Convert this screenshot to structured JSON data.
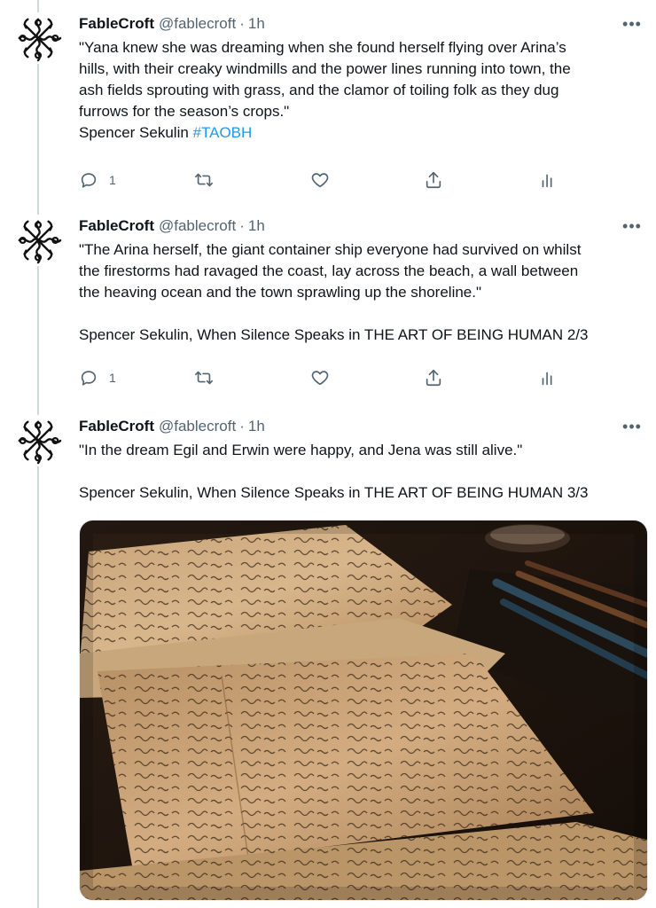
{
  "author": {
    "name": "FableCroft",
    "handle": "@fablecroft",
    "separator": "·",
    "avatar_icon": "celtic-knot-logo-icon"
  },
  "more_icon_label": "•••",
  "tweets": [
    {
      "time": "1h",
      "lines": [
        "\"Yana knew she was dreaming when she found herself flying over Arina’s",
        "hills, with their creaky windmills and the power lines running into town, the",
        "ash fields sprouting with grass, and the clamor of toiling folk as they dug",
        "furrows for the season’s crops.\""
      ],
      "attribution": "Spencer Sekulin",
      "hashtag": "#TAOBH",
      "reply_count": "1"
    },
    {
      "time": "1h",
      "lines": [
        "\"The Arina herself, the giant container ship everyone had survived on whilst",
        "the firestorms had ravaged the coast, lay across the beach, a wall between",
        "the heaving ocean and the town sprawling up the shoreline.\""
      ],
      "attribution": "Spencer Sekulin, When Silence Speaks in THE ART OF BEING HUMAN 2/3",
      "reply_count": "1"
    },
    {
      "time": "1h",
      "lines": [
        "\"In the dream Egil and Erwin were happy, and Jena was still alive.\""
      ],
      "attribution": "Spencer Sekulin, When Silence Speaks in THE ART OF BEING HUMAN 3/3"
    }
  ],
  "colors": {
    "text": "#0f1419",
    "secondary": "#536471",
    "link": "#1d9bf0",
    "thread_line": "#cfd9de"
  }
}
